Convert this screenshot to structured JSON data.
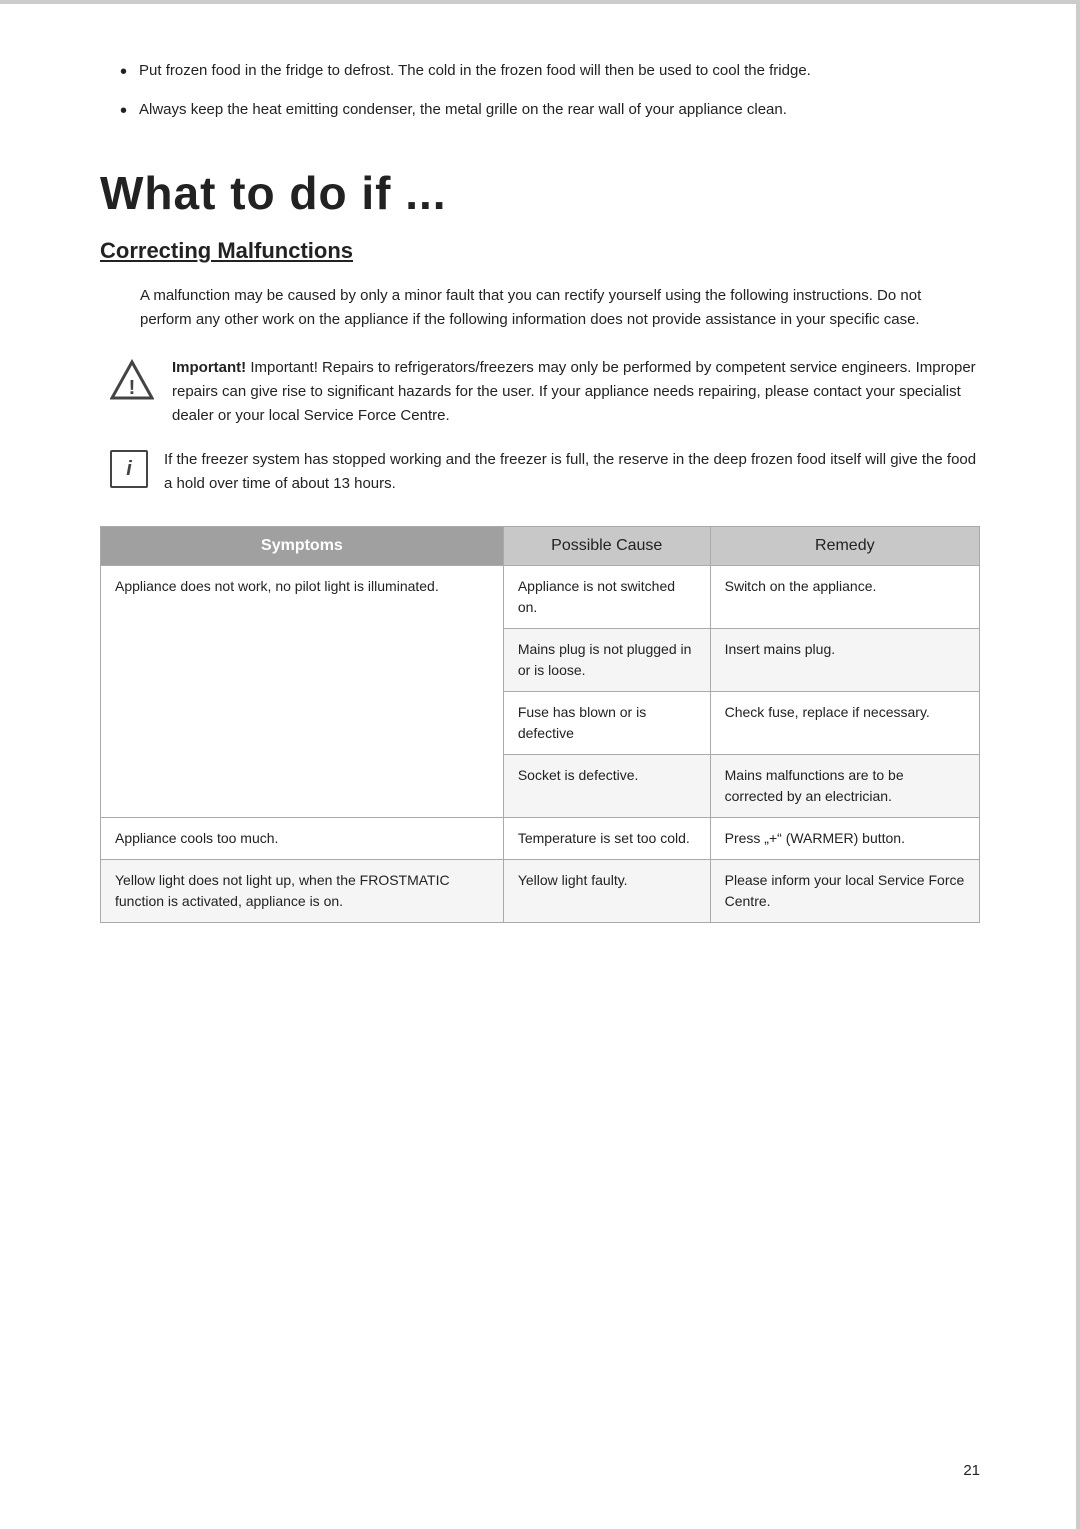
{
  "page": {
    "number": "21"
  },
  "bullets": [
    {
      "text": "Put frozen food in the fridge to defrost. The cold in the frozen food will then be used to cool the fridge."
    },
    {
      "text": "Always keep the heat emitting condenser, the metal grille on the rear wall of your appliance clean."
    }
  ],
  "section": {
    "main_title": "What to do if ...",
    "sub_title": "Correcting Malfunctions",
    "description": "A malfunction may be caused by only a minor fault that you can rectify yourself using the following instructions. Do not perform any other work on the appliance if the following information does not provide assistance in your specific case.",
    "warning_text": "Important! Repairs to refrigerators/freezers may only be performed by competent service engineers. Improper repairs can give rise to significant hazards for the user. If your appliance needs repairing, please contact your specialist dealer or your local Service Force Centre.",
    "info_text": "If the freezer system has stopped working and the freezer is full, the reserve in the deep frozen food itself will give the food a hold over time of about 13 hours."
  },
  "table": {
    "headers": {
      "symptoms": "Symptoms",
      "possible_cause": "Possible Cause",
      "remedy": "Remedy"
    },
    "rows": [
      {
        "symptoms": "Appliance does not work, no pilot light is illuminated.",
        "causes": [
          {
            "cause": "Appliance is not switched on.",
            "remedy": "Switch on the appliance."
          },
          {
            "cause": "Mains plug is not plugged in or is loose.",
            "remedy": "Insert mains plug."
          },
          {
            "cause": "Fuse has blown or is defective",
            "remedy": "Check fuse, replace if necessary."
          },
          {
            "cause": "Socket is defective.",
            "remedy": "Mains malfunctions are to be corrected by an electrician."
          }
        ]
      },
      {
        "symptoms": "Appliance cools too much.",
        "causes": [
          {
            "cause": "Temperature is set too cold.",
            "remedy": "Press „+“ (WARMER) button."
          }
        ]
      },
      {
        "symptoms": "Yellow light does not light up, when the FROSTMATIC function is activated, appliance is on.",
        "causes": [
          {
            "cause": "Yellow light faulty.",
            "remedy": "Please inform your local Service Force Centre."
          }
        ]
      }
    ]
  }
}
